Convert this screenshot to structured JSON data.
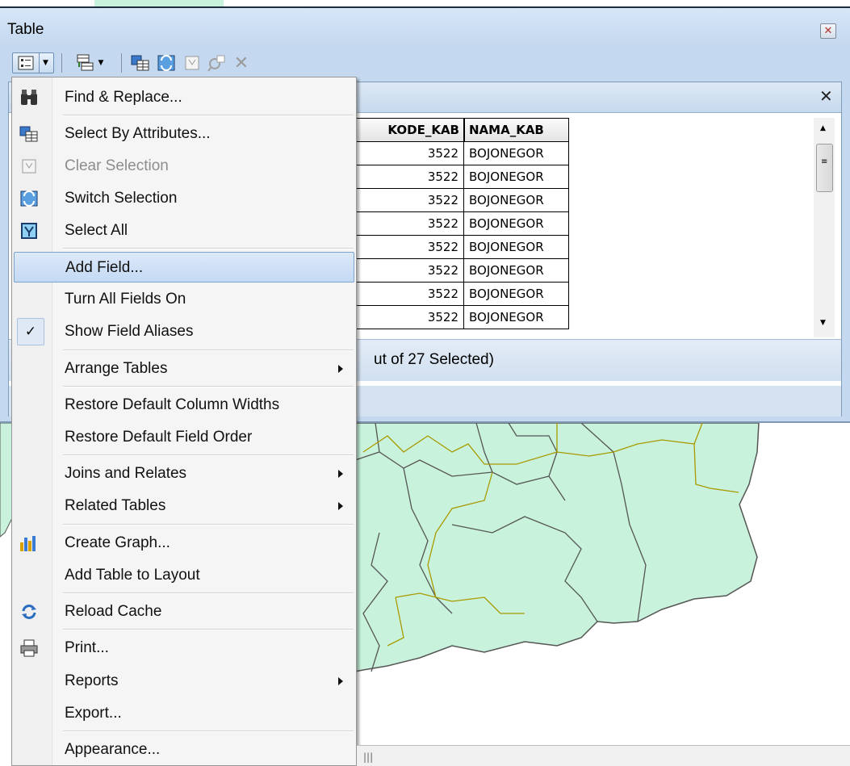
{
  "window": {
    "title": "Table"
  },
  "toolbar": {
    "icons": [
      "table-options-icon",
      "dropdown-arrow-icon",
      "related-tables-icon",
      "select-by-attributes-icon",
      "switch-selection-icon",
      "clear-selection-icon",
      "zoom-to-selected-icon",
      "delete-selected-icon"
    ]
  },
  "grid": {
    "columns": [
      "KODE_KAB",
      "NAMA_KAB"
    ],
    "rows": [
      [
        "3522",
        "BOJONEGOR"
      ],
      [
        "3522",
        "BOJONEGOR"
      ],
      [
        "3522",
        "BOJONEGOR"
      ],
      [
        "3522",
        "BOJONEGOR"
      ],
      [
        "3522",
        "BOJONEGOR"
      ],
      [
        "3522",
        "BOJONEGOR"
      ],
      [
        "3522",
        "BOJONEGOR"
      ],
      [
        "3522",
        "BOJONEGOR"
      ]
    ]
  },
  "status": {
    "text": "ut of 27 Selected)"
  },
  "menu": {
    "items": [
      {
        "label": "Find & Replace...",
        "icon": "binoculars-icon"
      },
      {
        "label": "Select By Attributes...",
        "icon": "select-by-attributes-icon"
      },
      {
        "label": "Clear Selection",
        "icon": "clear-selection-icon",
        "disabled": true
      },
      {
        "label": "Switch Selection",
        "icon": "switch-selection-icon"
      },
      {
        "label": "Select All",
        "icon": "select-all-icon"
      },
      {
        "label": "Add Field...",
        "highlighted": true
      },
      {
        "label": "Turn All Fields On"
      },
      {
        "label": "Show Field Aliases",
        "checked": true
      },
      {
        "label": "Arrange Tables",
        "submenu": true
      },
      {
        "label": "Restore Default Column Widths"
      },
      {
        "label": "Restore Default Field Order"
      },
      {
        "label": "Joins and Relates",
        "submenu": true
      },
      {
        "label": "Related Tables",
        "submenu": true
      },
      {
        "label": "Create Graph...",
        "icon": "bar-chart-icon"
      },
      {
        "label": "Add Table to Layout"
      },
      {
        "label": "Reload Cache",
        "icon": "refresh-icon"
      },
      {
        "label": "Print...",
        "icon": "printer-icon"
      },
      {
        "label": "Reports",
        "submenu": true
      },
      {
        "label": "Export..."
      },
      {
        "label": "Appearance..."
      }
    ]
  },
  "colors": {
    "highlight": "#c3d9f4",
    "map_fill": "#c8f2dc",
    "boundary_yellow": "#a99a00"
  }
}
